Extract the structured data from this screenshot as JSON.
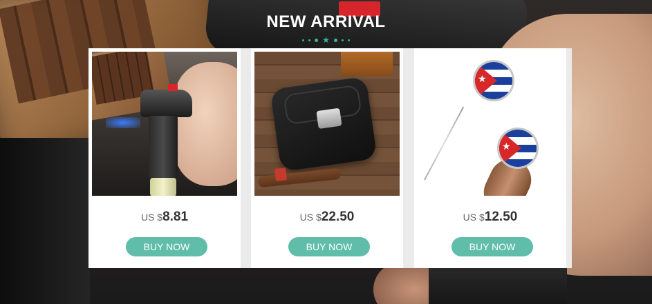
{
  "header": {
    "title": "NEW ARRIVAL"
  },
  "products": [
    {
      "image_icon": "torch-lighter-icon",
      "currency": "US $",
      "price": "8.81",
      "button_label": "BUY NOW"
    },
    {
      "image_icon": "leather-cigar-case-icon",
      "currency": "US $",
      "price": "22.50",
      "button_label": "BUY NOW"
    },
    {
      "image_icon": "cuban-flag-cigar-pick-icon",
      "currency": "US $",
      "price": "12.50",
      "button_label": "BUY NOW"
    }
  ],
  "colors": {
    "accent": "#5fbdaa",
    "ornament": "#3fb39b",
    "title": "#ffffff"
  }
}
